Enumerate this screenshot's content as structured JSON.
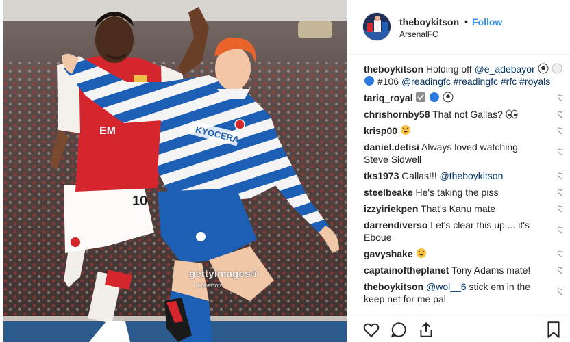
{
  "post": {
    "watermark_main": "gettyimages®",
    "watermark_sub": "Popperfoto",
    "jersey_number": "10",
    "shirt_sponsor": "KYOCERA",
    "shirt_text": "EM"
  },
  "header": {
    "username": "theboykitson",
    "separator": "•",
    "follow_label": "Follow",
    "location": "ArsenalFC"
  },
  "caption": {
    "username": "theboykitson",
    "text_prefix": "Holding off ",
    "mention": "@e_adebayor",
    "mid_text": " #106 ",
    "hashtags": "@readingfc #readingfc #rfc #royals"
  },
  "comments": [
    {
      "username": "tariq_royal",
      "text": ""
    },
    {
      "username": "chrishornby58",
      "text": "That not Gallas?"
    },
    {
      "username": "krisp00",
      "text": ""
    },
    {
      "username": "daniel.detisi",
      "text": "Always loved watching Steve Sidwell"
    },
    {
      "username": "tks1973",
      "text": "Gallas!!! ",
      "mention": "@theboykitson"
    },
    {
      "username": "steelbeake",
      "text": "He's taking the piss"
    },
    {
      "username": "izzyiriekpen",
      "text": "That's Kanu mate"
    },
    {
      "username": "darrendiverso",
      "text": "Let's clear this up.... it's Eboue"
    },
    {
      "username": "gavyshake",
      "text": ""
    },
    {
      "username": "captainoftheplanet",
      "text": "Tony Adams mate!"
    },
    {
      "username": "theboykitson",
      "text": " stick em in the keep net for me pal",
      "mention": "@wol__6"
    }
  ],
  "icons": {
    "like": "heart-icon",
    "comment": "comment-icon",
    "share": "share-icon",
    "save": "bookmark-icon"
  },
  "colors": {
    "link": "#003569",
    "follow": "#3897f0",
    "arsenal_red": "#d6262d",
    "reading_blue": "#1d5fb5"
  }
}
